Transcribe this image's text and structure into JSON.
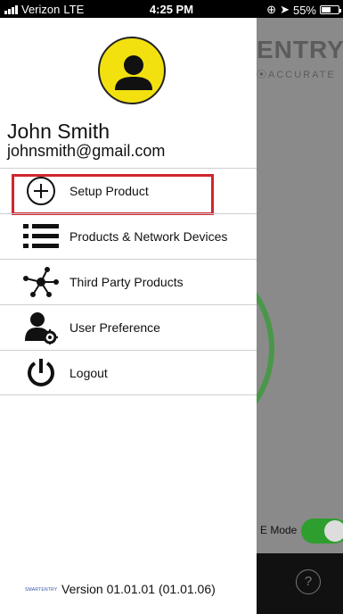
{
  "status_bar": {
    "carrier": "Verizon",
    "network": "LTE",
    "time": "4:25 PM",
    "battery": "55%"
  },
  "drawer": {
    "user": {
      "name": "John Smith",
      "email": "johnsmith@gmail.com",
      "avatar_icon": "person-icon"
    },
    "menu": [
      {
        "label": "Setup Product",
        "icon": "plus-circle-icon"
      },
      {
        "label": "Products & Network Devices",
        "icon": "list-icon"
      },
      {
        "label": "Third Party Products",
        "icon": "network-nodes-icon"
      },
      {
        "label": "User Preference",
        "icon": "user-settings-icon"
      },
      {
        "label": "Logout",
        "icon": "power-icon"
      }
    ],
    "footer": {
      "logo_text": "SMARTENTRY",
      "version": "Version 01.01.01 (01.01.06)"
    }
  },
  "background_app": {
    "brand": "ENTRY",
    "tagline": "ACCURATE",
    "mode_label": "E Mode",
    "help_label": "?"
  },
  "colors": {
    "highlight": "#d0262e",
    "avatar_bg": "#f2e10f",
    "toggle_on": "#2e9e2e"
  }
}
